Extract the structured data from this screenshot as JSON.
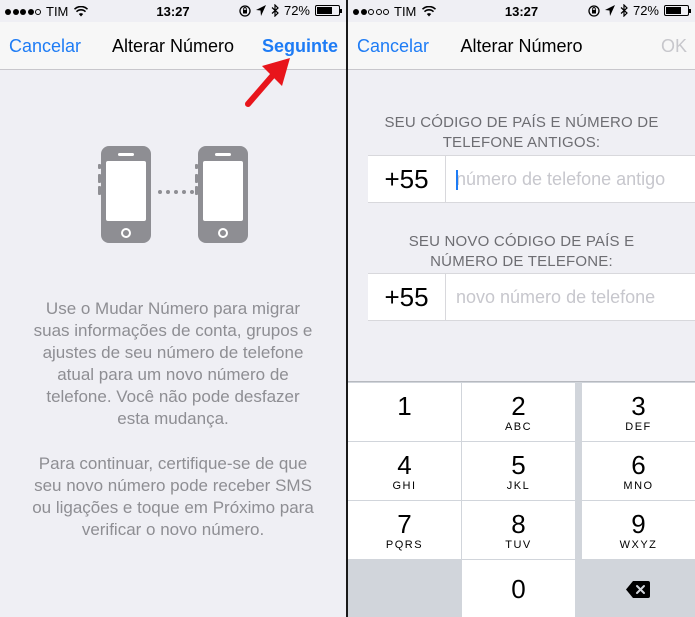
{
  "left_screen": {
    "status": {
      "carrier": "TIM",
      "time": "13:27",
      "battery": "72%"
    },
    "nav": {
      "cancel_label": "Cancelar",
      "title": "Alterar Número",
      "next_label": "Seguinte"
    },
    "paragraph1": [
      "Use o Mudar Número para migrar",
      "suas informações de conta, grupos e",
      "ajustes de seu número de telefone",
      "atual para um novo número de",
      "telefone. Você não pode desfazer",
      "esta mudança."
    ],
    "paragraph2": [
      "Para continuar, certifique-se de que",
      "seu novo número pode receber SMS",
      "ou ligações e toque em Próximo para",
      "verificar o novo número."
    ],
    "dots": "....."
  },
  "right_screen": {
    "status": {
      "carrier": "TIM",
      "time": "13:27",
      "battery": "72%"
    },
    "nav": {
      "cancel_label": "Cancelar",
      "title": "Alterar Número",
      "ok_label": "OK"
    },
    "old_section": {
      "label_line1": "SEU CÓDIGO DE PAÍS E NÚMERO DE",
      "label_line2": "TELEFONE ANTIGOS:",
      "country_code": "+55",
      "placeholder": "número de telefone antigo"
    },
    "new_section": {
      "label_line1": "SEU NOVO CÓDIGO DE PAÍS E",
      "label_line2": "NÚMERO DE TELEFONE:",
      "country_code": "+55",
      "placeholder": "novo número de telefone"
    },
    "keypad": {
      "keys": [
        {
          "num": "1",
          "letters": ""
        },
        {
          "num": "2",
          "letters": "ABC"
        },
        {
          "num": "3",
          "letters": "DEF"
        },
        {
          "num": "4",
          "letters": "GHI"
        },
        {
          "num": "5",
          "letters": "JKL"
        },
        {
          "num": "6",
          "letters": "MNO"
        },
        {
          "num": "7",
          "letters": "PQRS"
        },
        {
          "num": "8",
          "letters": "TUV"
        },
        {
          "num": "9",
          "letters": "WXYZ"
        },
        {
          "num": "0",
          "letters": ""
        }
      ]
    }
  },
  "colors": {
    "accent": "#1e7cf5",
    "arrow": "#e8151b",
    "icon_gray": "#8e8e93"
  },
  "icons": [
    "wifi-icon",
    "lock-rotation-icon",
    "location-arrow-icon",
    "bluetooth-icon",
    "battery-icon",
    "phone-icon",
    "delete-key-icon",
    "red-arrow-annotation"
  ]
}
